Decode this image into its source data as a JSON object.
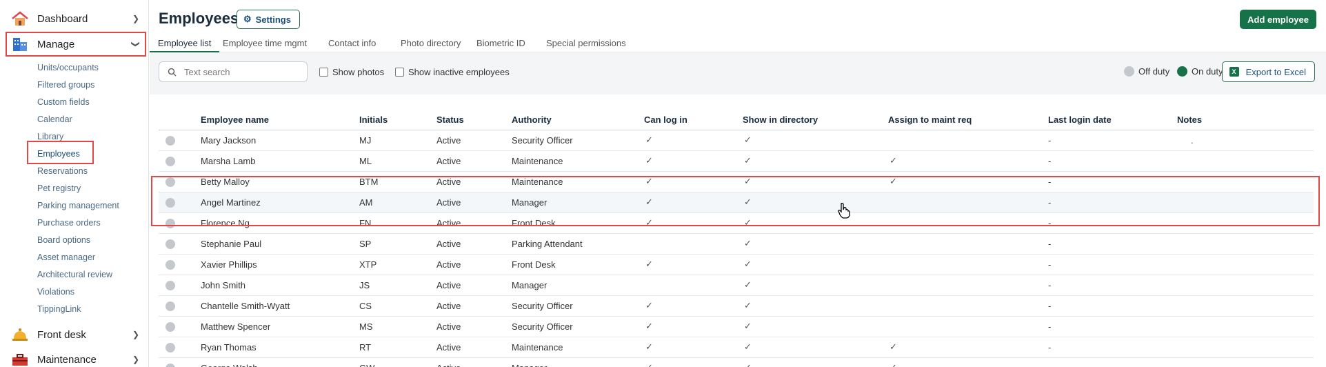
{
  "sidebar": {
    "dashboard": "Dashboard",
    "manage": "Manage",
    "front_desk": "Front desk",
    "maintenance": "Maintenance",
    "items": [
      "Units/occupants",
      "Filtered groups",
      "Custom fields",
      "Calendar",
      "Library",
      "Employees",
      "Reservations",
      "Pet registry",
      "Parking management",
      "Purchase orders",
      "Board options",
      "Asset manager",
      "Architectural review",
      "Violations",
      "TippingLink"
    ]
  },
  "header": {
    "title": "Employees",
    "settings_label": "Settings",
    "add_label": "Add employee"
  },
  "tabs": [
    "Employee list",
    "Employee time mgmt",
    "Contact info",
    "Photo directory",
    "Biometric ID",
    "Special permissions"
  ],
  "filters": {
    "search_placeholder": "Text search",
    "show_photos": "Show photos",
    "show_inactive": "Show inactive employees",
    "off_duty": "Off duty",
    "on_duty": "On duty",
    "export_label": "Export to Excel"
  },
  "colors": {
    "accent": "#157249",
    "off_duty": "#c4c8cc",
    "on_duty": "#157249",
    "highlight": "#e04848"
  },
  "table": {
    "columns": [
      "Employee name",
      "Initials",
      "Status",
      "Authority",
      "Can log in",
      "Show in directory",
      "Assign to maint req",
      "Last login date",
      "Notes"
    ],
    "rows": [
      {
        "name": "Mary Jackson",
        "initials": "MJ",
        "status": "Active",
        "authority": "Security Officer",
        "login": true,
        "dir": true,
        "maint": false,
        "last": "-",
        "notes": "."
      },
      {
        "name": "Marsha Lamb",
        "initials": "ML",
        "status": "Active",
        "authority": "Maintenance",
        "login": true,
        "dir": true,
        "maint": true,
        "last": "-",
        "notes": ""
      },
      {
        "name": "Betty Malloy",
        "initials": "BTM",
        "status": "Active",
        "authority": "Maintenance",
        "login": true,
        "dir": true,
        "maint": true,
        "last": "-",
        "notes": ""
      },
      {
        "name": "Angel Martinez",
        "initials": "AM",
        "status": "Active",
        "authority": "Manager",
        "login": true,
        "dir": true,
        "maint": false,
        "last": "-",
        "notes": ""
      },
      {
        "name": "Florence Ng",
        "initials": "FN",
        "status": "Active",
        "authority": "Front Desk",
        "login": true,
        "dir": true,
        "maint": false,
        "last": "-",
        "notes": ""
      },
      {
        "name": "Stephanie Paul",
        "initials": "SP",
        "status": "Active",
        "authority": "Parking Attendant",
        "login": false,
        "dir": true,
        "maint": false,
        "last": "-",
        "notes": ""
      },
      {
        "name": "Xavier Phillips",
        "initials": "XTP",
        "status": "Active",
        "authority": "Front Desk",
        "login": true,
        "dir": true,
        "maint": false,
        "last": "-",
        "notes": ""
      },
      {
        "name": "John Smith",
        "initials": "JS",
        "status": "Active",
        "authority": "Manager",
        "login": false,
        "dir": true,
        "maint": false,
        "last": "-",
        "notes": ""
      },
      {
        "name": "Chantelle Smith-Wyatt",
        "initials": "CS",
        "status": "Active",
        "authority": "Security Officer",
        "login": true,
        "dir": true,
        "maint": false,
        "last": "-",
        "notes": ""
      },
      {
        "name": "Matthew Spencer",
        "initials": "MS",
        "status": "Active",
        "authority": "Security Officer",
        "login": true,
        "dir": true,
        "maint": false,
        "last": "-",
        "notes": ""
      },
      {
        "name": "Ryan Thomas",
        "initials": "RT",
        "status": "Active",
        "authority": "Maintenance",
        "login": true,
        "dir": true,
        "maint": true,
        "last": "-",
        "notes": ""
      },
      {
        "name": "George Walsh",
        "initials": "GW",
        "status": "Active",
        "authority": "Manager",
        "login": true,
        "dir": true,
        "maint": true,
        "last": "-",
        "notes": ""
      }
    ],
    "check_glyph": "✓"
  }
}
